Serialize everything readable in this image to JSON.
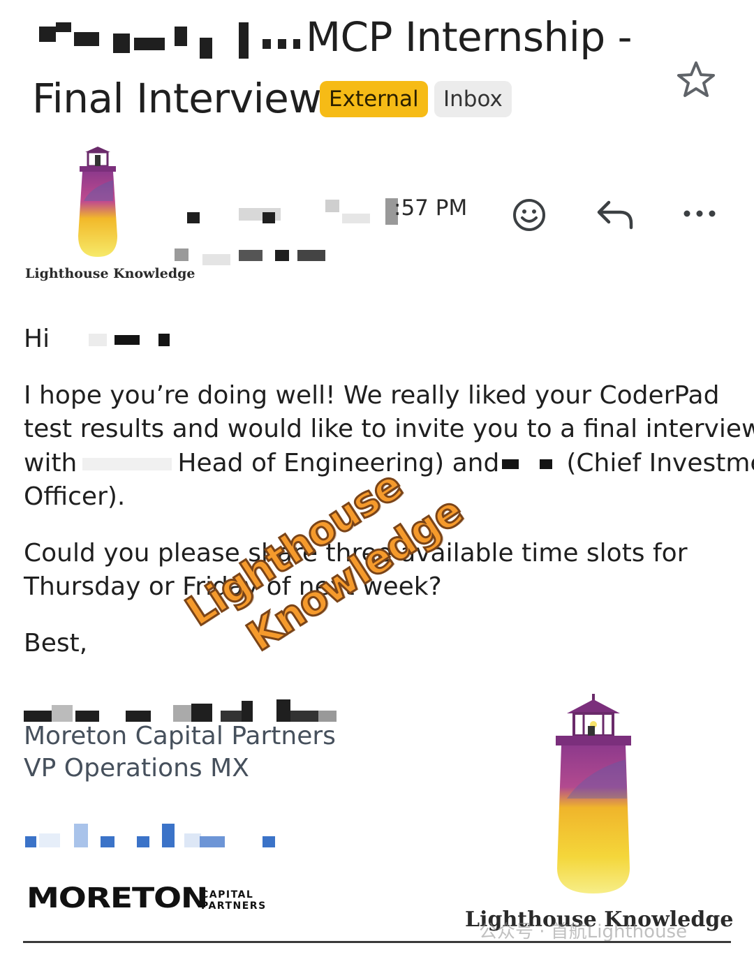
{
  "email": {
    "subject_part1": "MCP Internship -",
    "subject_part2": "Final Interview",
    "labels": [
      {
        "text": "External",
        "color": "#f6bb16"
      },
      {
        "text": "Inbox",
        "color": "#ececec"
      }
    ],
    "time": ":57 PM",
    "actions": {
      "star_icon": "star-outline-icon",
      "emoji_icon": "emoji-reaction-icon",
      "reply_icon": "reply-icon",
      "more_icon": "more-horizontal-icon"
    }
  },
  "sender_logo": {
    "caption": "Lighthouse Knowledge"
  },
  "body": {
    "greeting": "Hi",
    "line1": "I hope you’re doing well! We really liked your CoderPad",
    "line2": "test results and would like to invite you to a final interview",
    "line3a": "with",
    "line3b": "Head of Engineering) and",
    "line3c": "(Chief Investment",
    "line4": "Officer).",
    "line5": "Could you please share three available time slots for",
    "line6": "Thursday or Friday of next week?",
    "signoff": "Best,"
  },
  "signature": {
    "company": "Moreton Capital Partners",
    "role": "VP Operations MX",
    "logo_word": "MORETON",
    "logo_sub1": "CAPITAL",
    "logo_sub2": "PARTNERS"
  },
  "overlay": {
    "watermark_line1": "Lighthouse",
    "watermark_line2": "Knowledge",
    "lighthouse_caption": "Lighthouse Knowledge",
    "wechat_text": "公众号 · 首航Lighthouse"
  },
  "colors": {
    "accent_label": "#f6bb16",
    "watermark": "#f59a2c",
    "lighthouse_purple": "#8e3a8c",
    "lighthouse_yellow": "#f2d12c"
  }
}
